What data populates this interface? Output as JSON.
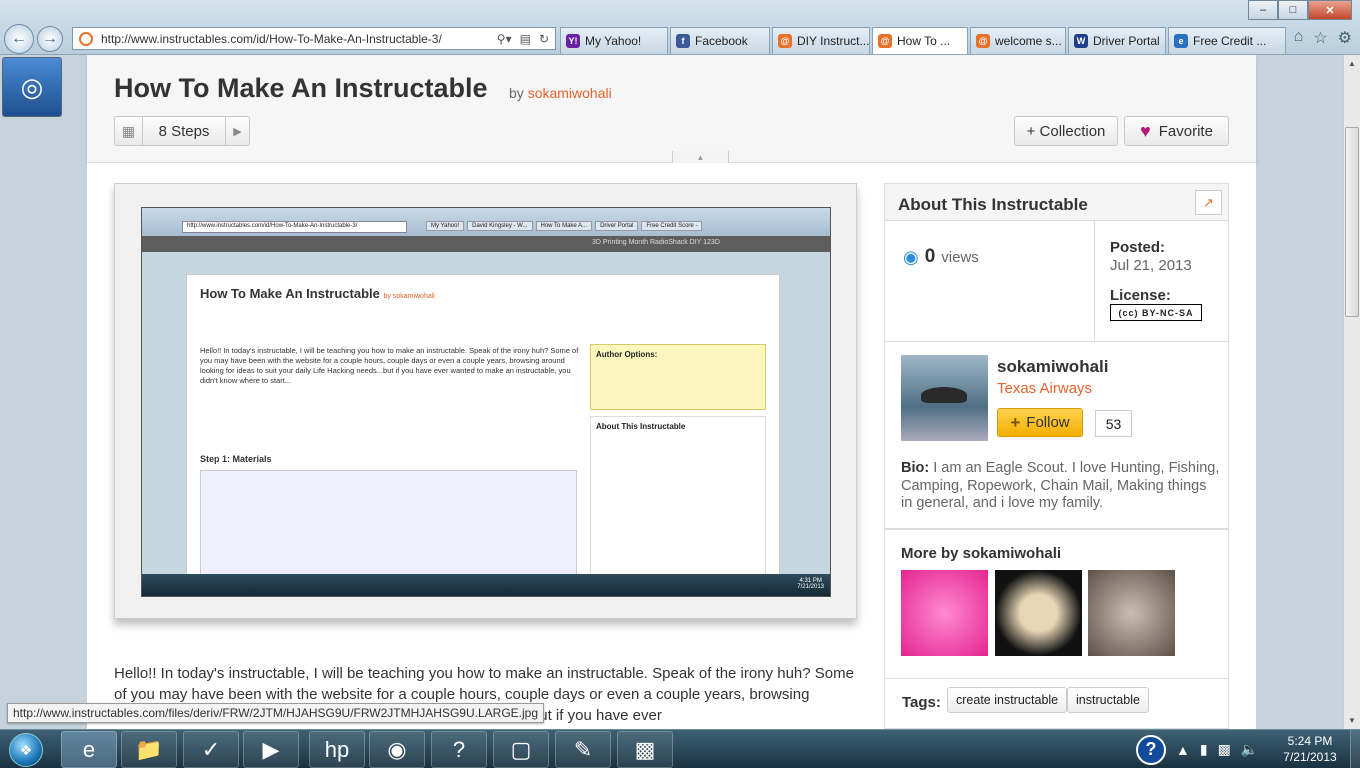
{
  "browser": {
    "url": "http://www.instructables.com/id/How-To-Make-An-Instructable-3/",
    "tabs": [
      {
        "label": "My Yahoo!",
        "color": "#6b1fa3",
        "glyph": "Y!"
      },
      {
        "label": "Facebook",
        "color": "#3b5998",
        "glyph": "f"
      },
      {
        "label": "DIY Instruct...",
        "color": "#e8722c",
        "glyph": "@"
      },
      {
        "label": "How To ...",
        "color": "#e8722c",
        "glyph": "@"
      },
      {
        "label": "welcome s...",
        "color": "#e8722c",
        "glyph": "@"
      },
      {
        "label": "Driver Portal",
        "color": "#1e3f8b",
        "glyph": "W"
      },
      {
        "label": "Free Credit ...",
        "color": "#2a6fc0",
        "glyph": "e"
      }
    ],
    "controls": {
      "minimize": "–",
      "maximize": "□",
      "close": "✕"
    },
    "right_icons": [
      "home-icon",
      "star-icon",
      "gear-icon"
    ]
  },
  "header": {
    "title": "How To Make An Instructable",
    "by": "by",
    "author": "sokamiwohali",
    "steps_label": "8 Steps",
    "collection_label": "+ Collection",
    "favorite_label": "Favorite"
  },
  "screenshot_thumb": {
    "url": "http://www.instructables.com/id/How-To-Make-An-Instructable-3/",
    "tabs": [
      "My Yahoo!",
      "David Kingsley - W...",
      "How To Make A...",
      "Driver Portal",
      "Free Credit Score -"
    ],
    "strip": "3D Printing Month   RadioShack DIY   123D",
    "title": "How To Make An Instructable",
    "by": "by sokamiwohali",
    "body": "Hello!! In today's instructable, I will be teaching you how to make an instructable. Speak of the irony huh? Some of you may have been with the website for a couple hours, couple days or even a couple years, browsing around looking for ideas to suit your daily Life Hacking needs...but if you have ever wanted to make an instructable, you didn't know where to start...",
    "step": "Step 1: Materials",
    "author_options": "Author Options:",
    "about": "About This Instructable",
    "time": "4:31 PM",
    "date": "7/21/2013"
  },
  "about": {
    "title": "About This Instructable",
    "views_count": "0",
    "views_label": "views",
    "posted_label": "Posted:",
    "posted_date": "Jul 21, 2013",
    "license_label": "License:",
    "license_badge": "(cc) BY-NC-SA"
  },
  "author": {
    "name": "sokamiwohali",
    "company": "Texas Airways",
    "follow_label": "Follow",
    "followers": "53",
    "bio_label": "Bio:",
    "bio": "I am an Eagle Scout. I love Hunting, Fishing, Camping, Ropework, Chain Mail, Making things in general, and i love my family."
  },
  "more": {
    "title": "More by sokamiwohali"
  },
  "tags": {
    "label": "Tags:",
    "items": [
      "create instructable",
      "instructable"
    ]
  },
  "intro_text": "Hello!! In today's instructable, I will be teaching you how to make an instructable. Speak of the irony huh? Some of you may have been with the website for a couple hours, couple days or even a couple years, browsing around looking for ideas to suit your daily Life Hacking needs...but if you have ever",
  "status_url": "http://www.instructables.com/files/deriv/FRW/2JTM/HJAHSG9U/FRW2JTMHJAHSG9U.LARGE.jpg",
  "taskbar": {
    "apps": [
      "ie-icon",
      "explorer-icon",
      "task-icon",
      "media-player-icon",
      "hp-icon",
      "globe-icon",
      "help-icon",
      "sticky-notes-icon",
      "paint-icon",
      "terminal-icon"
    ],
    "time": "5:24 PM",
    "date": "7/21/2013"
  }
}
